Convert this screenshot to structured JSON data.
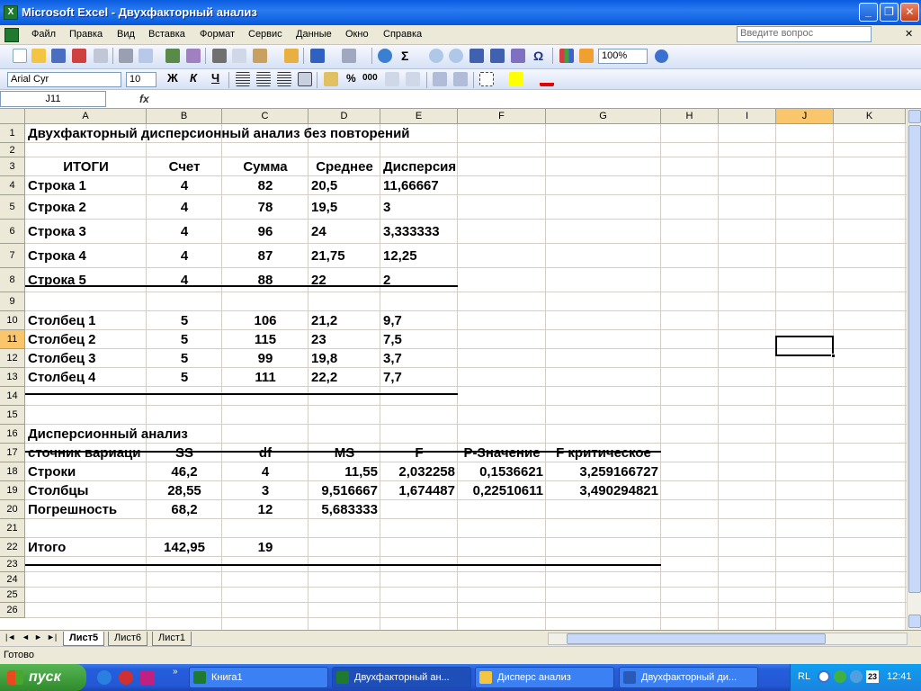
{
  "window": {
    "title": "Microsoft Excel - Двухфакторный анализ",
    "app_icon": "X",
    "minimize": "_",
    "restore": "❐",
    "close": "✕"
  },
  "menubar": {
    "items": [
      "Файл",
      "Правка",
      "Вид",
      "Вставка",
      "Формат",
      "Сервис",
      "Данные",
      "Окно",
      "Справка"
    ],
    "ask_placeholder": "Введите вопрос",
    "doc_close": "✕"
  },
  "toolbar": {
    "zoom": "100%",
    "font": "Arial Cyr",
    "size": "10",
    "bold": "Ж",
    "italic": "К",
    "underline": "Ч",
    "percent": "%",
    "thousands": "000",
    "sigma": "Σ",
    "omega": "Ω"
  },
  "formulabar": {
    "namebox": "J11",
    "fx": "fx"
  },
  "columns": [
    "A",
    "B",
    "C",
    "D",
    "E",
    "F",
    "G",
    "H",
    "I",
    "J",
    "K"
  ],
  "rows": [
    "1",
    "2",
    "3",
    "4",
    "5",
    "6",
    "7",
    "8",
    "9",
    "10",
    "11",
    "12",
    "13",
    "14",
    "15",
    "16",
    "17",
    "18",
    "19",
    "20",
    "21",
    "22",
    "23",
    "24",
    "25",
    "26"
  ],
  "sheet": {
    "r1": [
      "Двухфакторный дисперсионный анализ без повторений"
    ],
    "r3": [
      "ИТОГИ",
      "Счет",
      "Сумма",
      "Среднее",
      "Дисперсия"
    ],
    "r4": [
      "Строка 1",
      "4",
      "82",
      "20,5",
      "11,66667"
    ],
    "r5": [
      "Строка 2",
      "4",
      "78",
      "19,5",
      "3"
    ],
    "r6": [
      "Строка 3",
      "4",
      "96",
      "24",
      "3,333333"
    ],
    "r7": [
      "Строка 4",
      "4",
      "87",
      "21,75",
      "12,25"
    ],
    "r8": [
      "Строка 5",
      "4",
      "88",
      "22",
      "2"
    ],
    "r10": [
      "Столбец 1",
      "5",
      "106",
      "21,2",
      "9,7"
    ],
    "r11": [
      "Столбец 2",
      "5",
      "115",
      "23",
      "7,5"
    ],
    "r12": [
      "Столбец 3",
      "5",
      "99",
      "19,8",
      "3,7"
    ],
    "r13": [
      "Столбец 4",
      "5",
      "111",
      "22,2",
      "7,7"
    ],
    "r16": [
      "Дисперсионный анализ"
    ],
    "r17": [
      "сточник вариаци",
      "SS",
      "df",
      "MS",
      "F",
      "P-Значение",
      "F критическое"
    ],
    "r18": [
      "Строки",
      "46,2",
      "4",
      "11,55",
      "2,032258",
      "0,1536621",
      "3,259166727"
    ],
    "r19": [
      "Столбцы",
      "28,55",
      "3",
      "9,516667",
      "1,674487",
      "0,22510611",
      "3,490294821"
    ],
    "r20": [
      "Погрешность",
      "68,2",
      "12",
      "5,683333"
    ],
    "r22": [
      "Итого",
      "142,95",
      "19"
    ]
  },
  "sheettabs": [
    "Лист5",
    "Лист6",
    "Лист1"
  ],
  "status": "Готово",
  "taskbar": {
    "start": "пуск",
    "items": [
      "Книга1",
      "Двухфакторный ан...",
      "Дисперс анализ",
      "Двухфакторный ди..."
    ],
    "lang": "RL",
    "clock": "12:41",
    "tray_num": "23"
  }
}
